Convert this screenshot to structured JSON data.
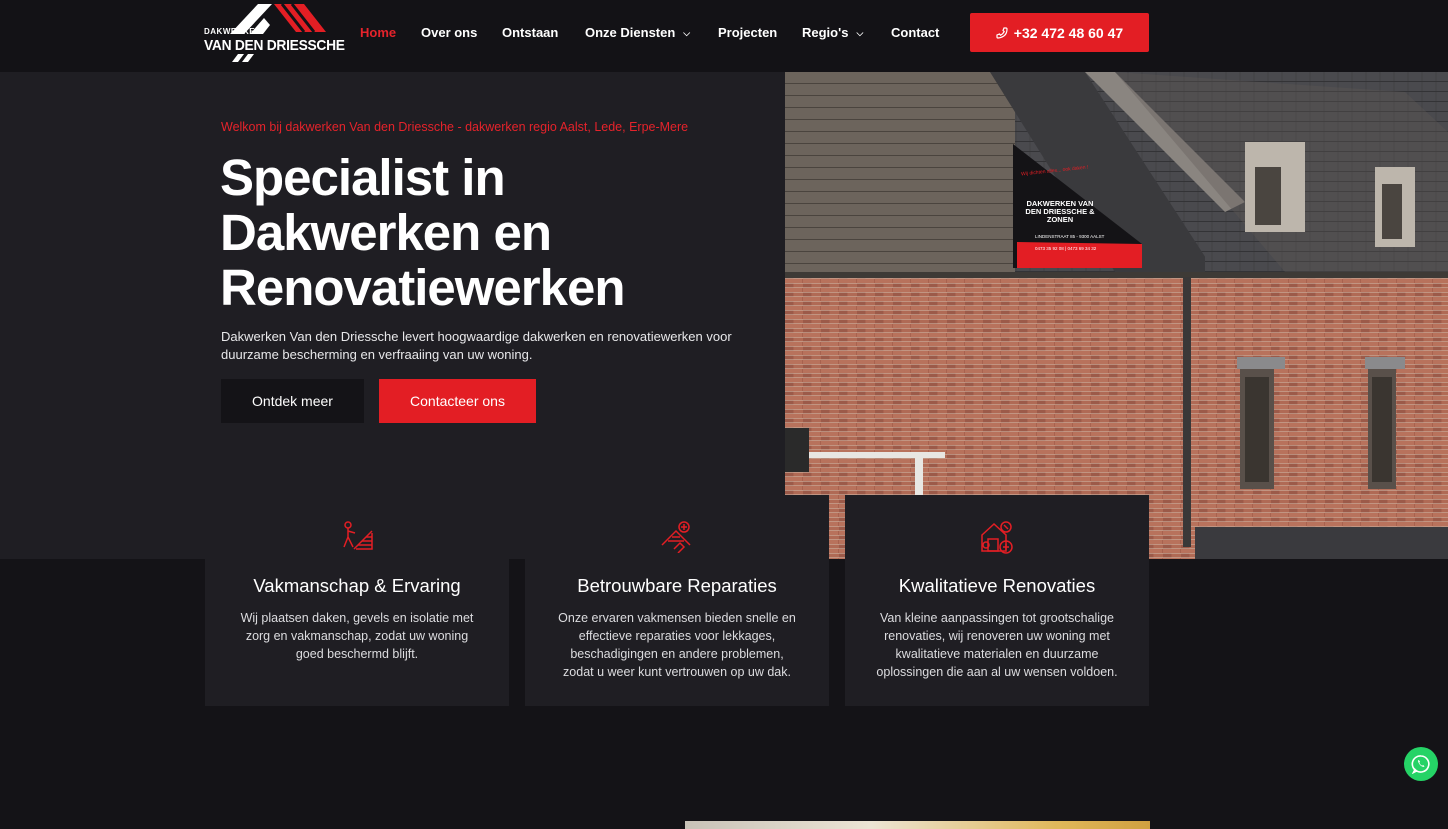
{
  "header": {
    "logo": {
      "line1": "DAKWERKEN",
      "line2": "VAN DEN DRIESSCHE"
    },
    "nav": [
      {
        "label": "Home",
        "active": true
      },
      {
        "label": "Over ons"
      },
      {
        "label": "Ontstaan"
      },
      {
        "label": "Onze Diensten",
        "dropdown": true
      },
      {
        "label": "Projecten"
      },
      {
        "label": "Regio's",
        "dropdown": true
      },
      {
        "label": "Contact"
      }
    ],
    "phone": "+32 472 48 60 47",
    "phone_icon": "phone-ringing-icon"
  },
  "hero": {
    "eyebrow": "Welkom bij dakwerken Van den Driessche - dakwerken regio Aalst, Lede, Erpe-Mere",
    "title": "Specialist in Dakwerken en Renovatiewerken",
    "description": "Dakwerken Van den Driessche levert hoogwaardige dakwerken en renovatiewerken voor duurzame bescherming en verfraaiing van uw woning.",
    "btn_primary": "Ontdek meer",
    "btn_secondary": "Contacteer ons",
    "image_alt": "house-with-slate-roof-and-brick-facade"
  },
  "sign": {
    "slogan": "Wij dichten alles... ook daken !",
    "name": "DAKWERKEN VAN DEN DRIESSCHE & ZONEN",
    "address": "LINDENSTRAAT 85 - 9300 AALST",
    "phones": "0473 35 92 08 | 0473 69 34 32"
  },
  "cards": [
    {
      "icon": "roofer-worker-icon",
      "title": "Vakmanschap & Ervaring",
      "text": "Wij plaatsen daken, gevels en isolatie met zorg en vakmanschap, zodat uw woning goed beschermd blijft."
    },
    {
      "icon": "roof-repair-icon",
      "title": "Betrouwbare Reparaties",
      "text": "Onze ervaren vakmensen bieden snelle en effectieve reparaties voor lekkages, beschadigingen en andere problemen, zodat u weer kunt vertrouwen op uw dak."
    },
    {
      "icon": "house-tools-icon",
      "title": "Kwalitatieve Renovaties",
      "text": "Van kleine aanpassingen tot grootschalige renovaties, wij renoveren uw woning met kwalitatieve materialen en duurzame oplossingen die aan al uw wensen voldoen."
    }
  ],
  "colors": {
    "accent": "#e31e24",
    "background": "#141317",
    "panel": "#1f1e23",
    "whatsapp": "#25d366"
  },
  "whatsapp_icon": "whatsapp-icon"
}
